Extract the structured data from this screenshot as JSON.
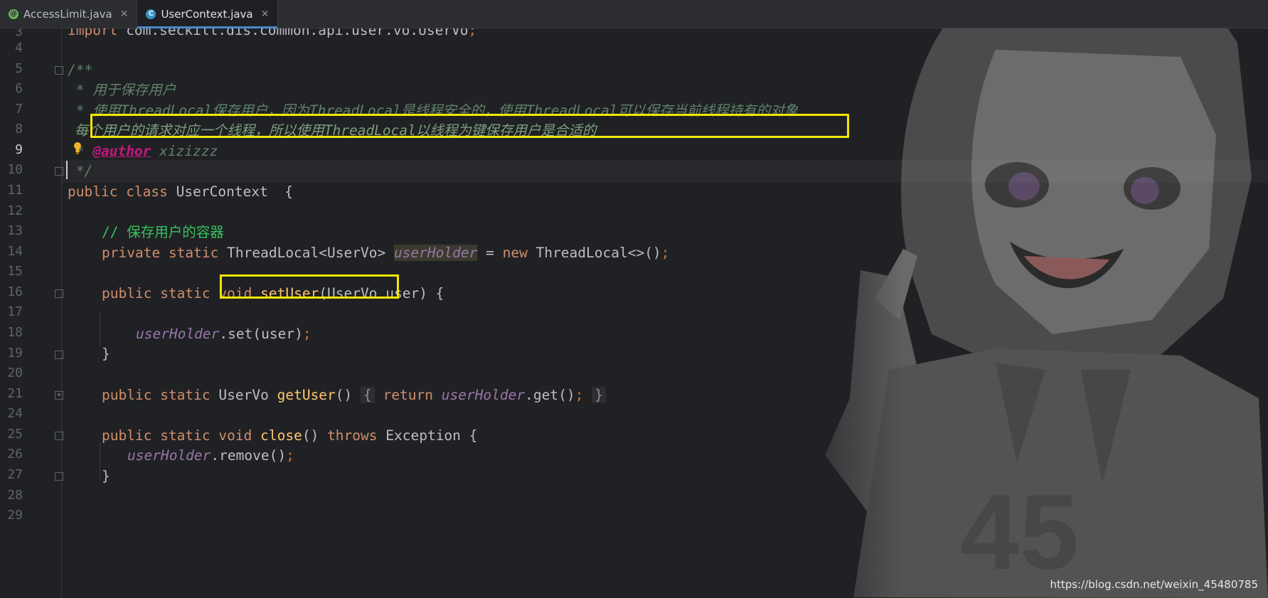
{
  "tabs": [
    {
      "label": "AccessLimit.java",
      "icon": "annotation-icon",
      "active": false
    },
    {
      "label": "UserContext.java",
      "icon": "class-icon",
      "active": true
    }
  ],
  "gutter": {
    "line_numbers": [
      "3",
      "4",
      "5",
      "6",
      "7",
      "8",
      "9",
      "10",
      "11",
      "12",
      "13",
      "14",
      "15",
      "16",
      "17",
      "18",
      "19",
      "20",
      "21",
      "24",
      "25",
      "26",
      "27",
      "28",
      "29"
    ],
    "current_line": "9"
  },
  "code": {
    "l3": {
      "kw": "import",
      "rest": " com.seckill.dis.common.api.user.vo.UserVo",
      "semi": ";"
    },
    "l5": "/**",
    "l6": " * 用于保存用户",
    "l7_star": " * ",
    "l7": "使用ThreadLocal保存用户，因为ThreadLocal是线程安全的，使用ThreadLocal可以保存当前线程持有的对象",
    "l8": " 每个用户的请求对应一个线程，所以使用ThreadLocal以线程为键保存用户是合适的",
    "l9_star": " * ",
    "l9_tag": "@author",
    "l9_name": " xizizzz",
    "l10": " */",
    "l11": {
      "kw1": "public",
      "kw2": "class",
      "name": "UserContext",
      "brace": "  {"
    },
    "l13": "// 保存用户的容器",
    "l14": {
      "kw1": "private",
      "kw2": "static",
      "type": "ThreadLocal<UserVo>",
      "field": "userHolder",
      "eq": " = ",
      "kw3": "new",
      "ctor": " ThreadLocal<>()",
      "semi": ";"
    },
    "l16": {
      "kw1": "public",
      "kw2": "static",
      "kw3": "void",
      "fn": "setUser",
      "params": "(UserVo user) {"
    },
    "l18": {
      "field": "userHolder",
      "rest": ".set(user)",
      "semi": ";"
    },
    "l19": "}",
    "l21": {
      "kw1": "public",
      "kw2": "static",
      "type": "UserVo",
      "fn": "getUser",
      "paren": "()",
      "open": "{",
      "kw3": "return",
      "field": "userHolder",
      "rest": ".get()",
      "semi": ";",
      "close": "}"
    },
    "l25": {
      "kw1": "public",
      "kw2": "static",
      "kw3": "void",
      "fn": "close",
      "paren": "()",
      "kw4": "throws",
      "rest": " Exception {"
    },
    "l26": {
      "field": "userHolder",
      "rest": ".remove()",
      "semi": ";"
    },
    "l27": "}"
  },
  "watermark": "https://blog.csdn.net/weixin_45480785"
}
